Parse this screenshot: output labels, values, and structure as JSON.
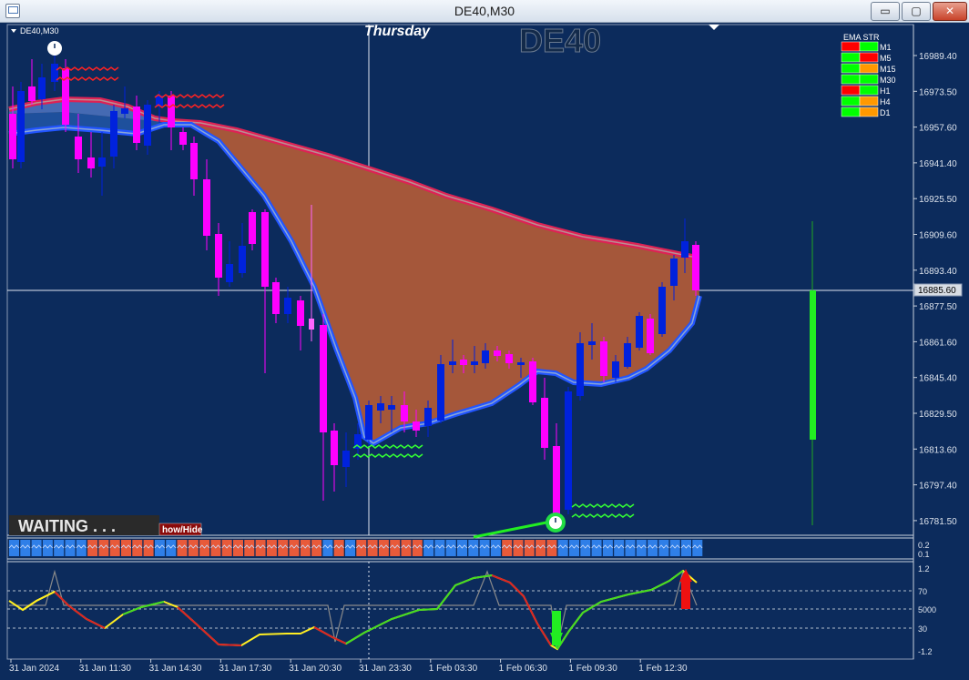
{
  "window": {
    "title": "DE40,M30",
    "minimize": "▭",
    "maximize": "▢",
    "close": "✕"
  },
  "chart": {
    "symbol_label": "DE40,M30",
    "day_label": "Thursday",
    "big_symbol": "DE40",
    "current_price": "16885.60",
    "waiting_text": "WAITING . . .",
    "show_hide": "how/Hide",
    "price_ticks": [
      "16989.40",
      "16973.50",
      "16957.60",
      "16941.40",
      "16925.50",
      "16909.60",
      "16893.40",
      "16877.50",
      "16861.60",
      "16845.40",
      "16829.50",
      "16813.60",
      "16797.40",
      "16781.50"
    ],
    "band_ticks": [
      "0.2",
      "0.1"
    ],
    "osc_ticks": [
      "1.2",
      "70",
      "5000",
      "30",
      "-1.2"
    ],
    "time_ticks": [
      "31 Jan 2024",
      "31 Jan 11:30",
      "31 Jan 14:30",
      "31 Jan 17:30",
      "31 Jan 20:30",
      "31 Jan 23:30",
      "1 Feb 03:30",
      "1 Feb 06:30",
      "1 Feb 09:30",
      "1 Feb 12:30"
    ]
  },
  "ema_str": {
    "title": "EMA STR",
    "rows": [
      {
        "tf": "M1",
        "c1": "#ff0000",
        "c2": "#00ff00"
      },
      {
        "tf": "M5",
        "c1": "#00ff00",
        "c2": "#ff0000"
      },
      {
        "tf": "M15",
        "c1": "#00ff00",
        "c2": "#ff9900"
      },
      {
        "tf": "M30",
        "c1": "#00ff00",
        "c2": "#00ff00"
      },
      {
        "tf": "H1",
        "c1": "#ff0000",
        "c2": "#00ff00"
      },
      {
        "tf": "H4",
        "c1": "#00ff00",
        "c2": "#ff9900"
      },
      {
        "tf": "D1",
        "c1": "#00ff00",
        "c2": "#ff9900"
      }
    ]
  },
  "colors": {
    "background": "#0c2b5c",
    "bull": "#0022dd",
    "bear": "#ff00ff",
    "cloud": "#a5573a",
    "upper_band": "#dd2255",
    "lower_band": "#2255ff"
  }
}
